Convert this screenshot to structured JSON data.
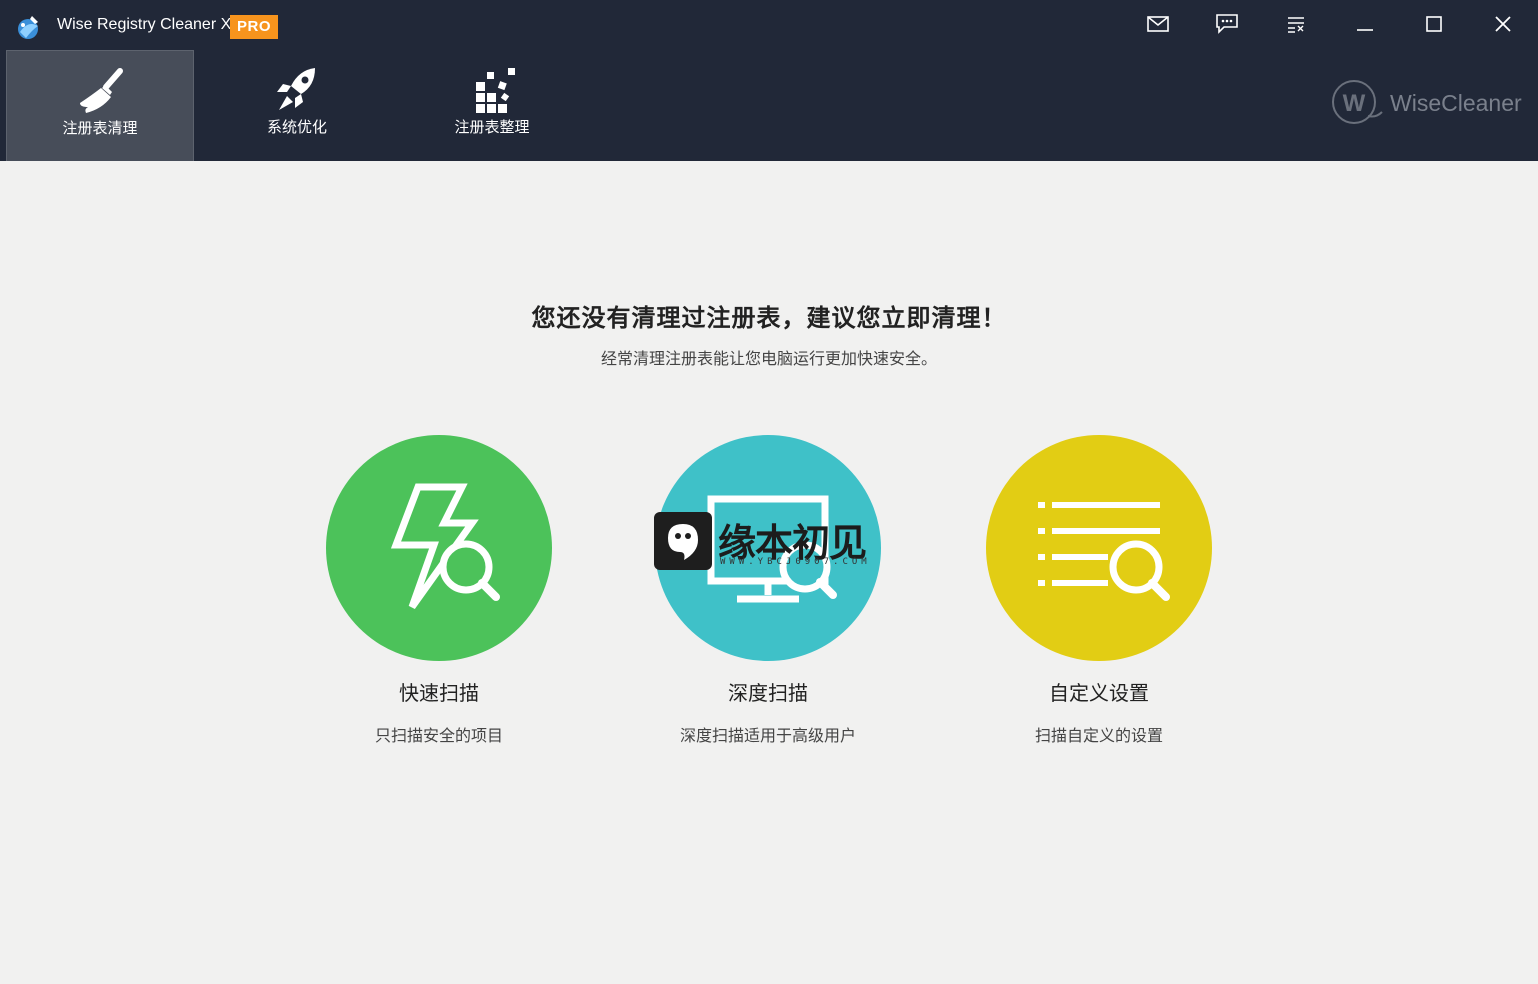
{
  "window": {
    "title": "Wise Registry Cleaner X",
    "badge": "PRO"
  },
  "nav": {
    "tabs": [
      {
        "label": "注册表清理",
        "icon": "broom-icon",
        "active": true
      },
      {
        "label": "系统优化",
        "icon": "rocket-icon",
        "active": false
      },
      {
        "label": "注册表整理",
        "icon": "defrag-blocks-icon",
        "active": false
      }
    ]
  },
  "brand": {
    "name": "WiseCleaner",
    "logo_letter": "W"
  },
  "main": {
    "headline": "您还没有清理过注册表，建议您立即清理！",
    "subline": "经常清理注册表能让您电脑运行更加快速安全。",
    "scans": [
      {
        "title": "快速扫描",
        "desc": "只扫描安全的项目",
        "icon": "bolt-search-icon",
        "color": "#4cc25a"
      },
      {
        "title": "深度扫描",
        "desc": "深度扫描适用于高级用户",
        "icon": "monitor-search-icon",
        "color": "#3fc1c8"
      },
      {
        "title": "自定义设置",
        "desc": "扫描自定义的设置",
        "icon": "list-search-icon",
        "color": "#e2cd14"
      }
    ]
  },
  "watermark": {
    "text": "缘本初见",
    "url": "WWW.YBCJ0907.COM"
  },
  "colors": {
    "titlebar": "#212838",
    "active_tab": "#474d59",
    "pro_badge": "#f7941d",
    "background": "#f1f1f0"
  }
}
